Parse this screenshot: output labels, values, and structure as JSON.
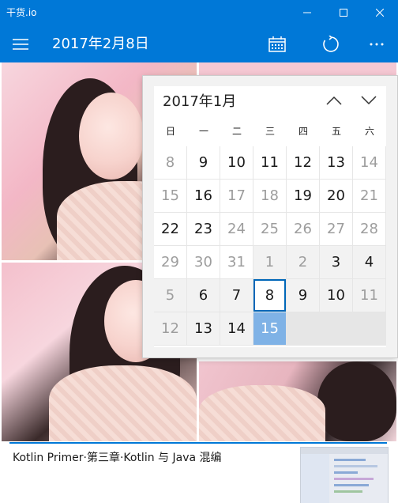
{
  "window": {
    "title": "干货.io"
  },
  "appbar": {
    "date_title": "2017年2月8日"
  },
  "calendar": {
    "month_label": "2017年1月",
    "weekdays": [
      "日",
      "一",
      "二",
      "三",
      "四",
      "五",
      "六"
    ],
    "rows": [
      [
        "8",
        "9",
        "10",
        "11",
        "12",
        "13",
        "14"
      ],
      [
        "15",
        "16",
        "17",
        "18",
        "19",
        "20",
        "21"
      ],
      [
        "22",
        "23",
        "24",
        "25",
        "26",
        "27",
        "28"
      ],
      [
        "29",
        "30",
        "31",
        "1",
        "2",
        "3",
        "4"
      ],
      [
        "5",
        "6",
        "7",
        "8",
        "9",
        "10",
        "11"
      ],
      [
        "12",
        "13",
        "14",
        "15"
      ]
    ]
  },
  "feed": {
    "article_title": "Kotlin Primer·第三章·Kotlin 与 Java 混编"
  }
}
